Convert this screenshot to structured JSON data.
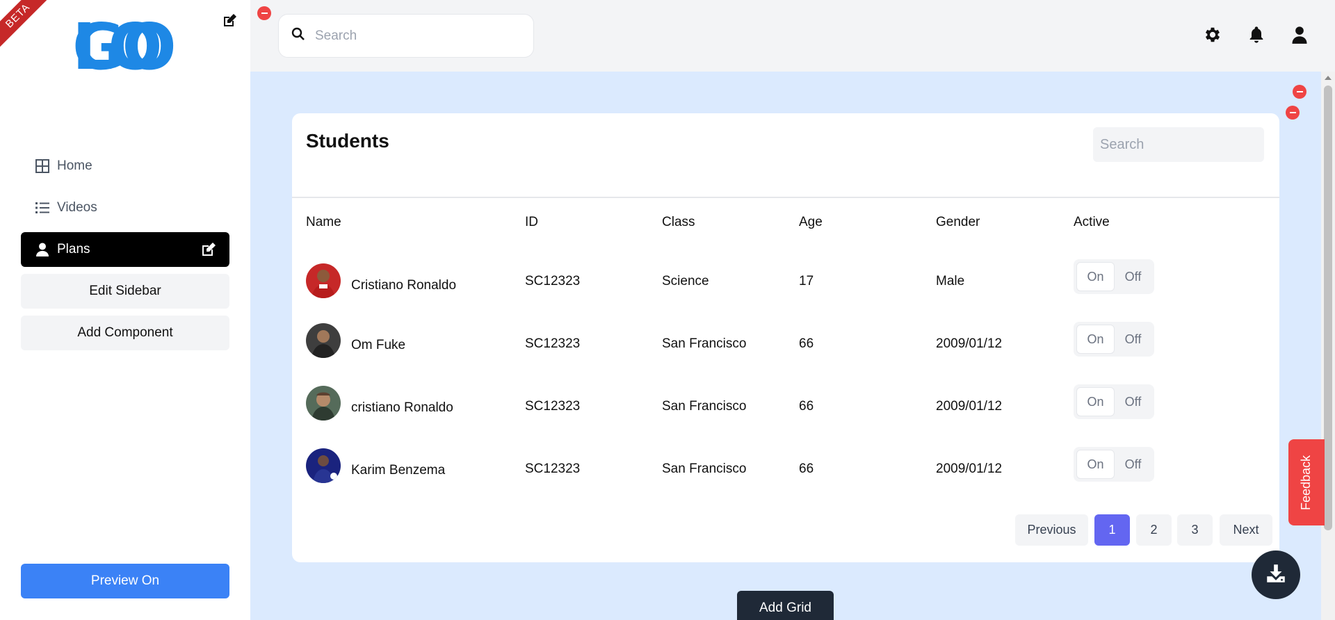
{
  "sidebar": {
    "beta": "BETA",
    "logo_line1": "LO",
    "logo_line2": "GO",
    "nav": [
      {
        "label": "Home",
        "icon": "grid-icon"
      },
      {
        "label": "Videos",
        "icon": "list-icon"
      },
      {
        "label": "Plans",
        "icon": "user-icon",
        "active": true
      }
    ],
    "edit_sidebar": "Edit Sidebar",
    "add_component": "Add Component",
    "preview": "Preview On"
  },
  "topbar": {
    "search_placeholder": "Search"
  },
  "card": {
    "title": "Students",
    "search_placeholder": "Search",
    "columns": [
      "Name",
      "ID",
      "Class",
      "Age",
      "Gender",
      "Active"
    ],
    "rows": [
      {
        "name": "Cristiano Ronaldo",
        "id": "SC12323",
        "class": "Science",
        "age": "17",
        "gender": "Male",
        "on": "On",
        "off": "Off"
      },
      {
        "name": "Om Fuke",
        "id": "SC12323",
        "class": "San Francisco",
        "age": "66",
        "gender": "2009/01/12",
        "on": "On",
        "off": "Off"
      },
      {
        "name": "cristiano Ronaldo",
        "id": "SC12323",
        "class": "San Francisco",
        "age": "66",
        "gender": "2009/01/12",
        "on": "On",
        "off": "Off"
      },
      {
        "name": "Karim Benzema",
        "id": "SC12323",
        "class": "San Francisco",
        "age": "66",
        "gender": "2009/01/12",
        "on": "On",
        "off": "Off"
      }
    ],
    "pagination": {
      "previous": "Previous",
      "pages": [
        "1",
        "2",
        "3"
      ],
      "next": "Next",
      "current": "1"
    }
  },
  "add_grid": "Add Grid",
  "feedback": "Feedback",
  "colors": {
    "accent": "#3b82f6",
    "active_page": "#6366f1",
    "logo": "#1e88e5",
    "danger": "#ef4444",
    "main_bg": "#dbeafe"
  }
}
